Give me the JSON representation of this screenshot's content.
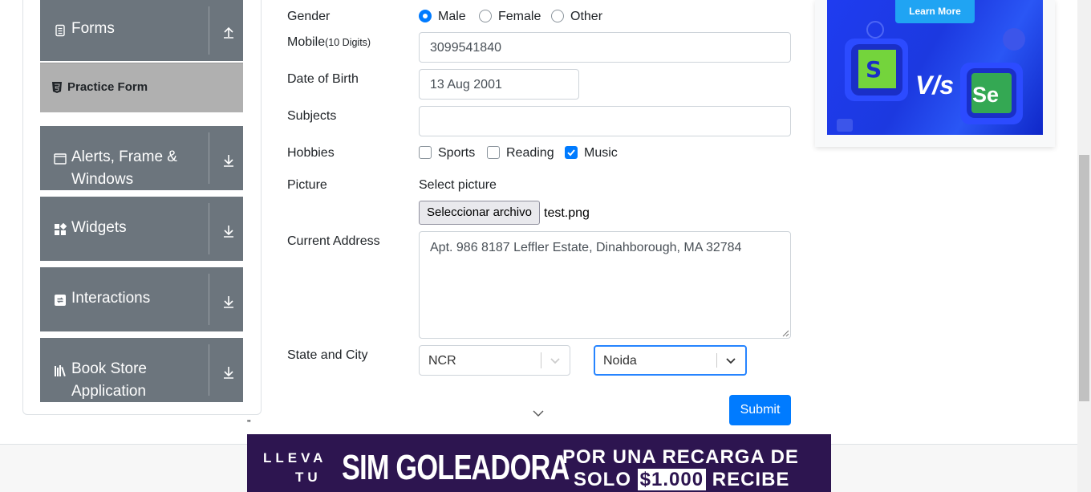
{
  "sidebar": {
    "groups": {
      "forms": "Forms",
      "alerts": "Alerts, Frame & Windows",
      "widgets": "Widgets",
      "interactions": "Interactions",
      "bookstore": "Book Store Application"
    },
    "active_item": "Practice Form"
  },
  "form": {
    "gender": {
      "label": "Gender",
      "options": [
        "Male",
        "Female",
        "Other"
      ],
      "selected": "Male"
    },
    "mobile": {
      "label": "Mobile",
      "note": "(10 Digits)",
      "value": "3099541840"
    },
    "dob": {
      "label": "Date of Birth",
      "value": "13 Aug 2001"
    },
    "subjects": {
      "label": "Subjects",
      "value": ""
    },
    "hobbies": {
      "label": "Hobbies",
      "options": [
        "Sports",
        "Reading",
        "Music"
      ],
      "checked": [
        "Music"
      ]
    },
    "picture": {
      "label": "Picture",
      "select_text": "Select picture",
      "button_label": "Seleccionar archivo",
      "file_name": "test.png"
    },
    "address": {
      "label": "Current Address",
      "value": "Apt. 986 8187 Leffler Estate, Dinahborough, MA 32784"
    },
    "state_city": {
      "label": "State and City",
      "state": "NCR",
      "city": "Noida"
    },
    "submit_label": "Submit"
  },
  "ads": {
    "top_right": {
      "button_label": "Learn More",
      "vs_text": "V/s",
      "left_logo": "S",
      "right_logo": "Se"
    },
    "bottom": {
      "line1": "LLEVA",
      "line2": "TU",
      "big_text": "SIM GOLEADORA",
      "right1": "POR UNA RECARGA DE",
      "right2_pre": "SOLO ",
      "right2_price": "$1.000",
      "right2_post": " RECIBE"
    }
  },
  "misc": {
    "stray_quote": "\""
  },
  "colors": {
    "primary": "#007bff",
    "sidebar_header": "#6c757d",
    "active_item": "#b0b0b0",
    "ad_blue": "#1f3cf0",
    "banner_purple": "#2d1550"
  },
  "icons": [
    "form-icon",
    "chevron-up-icon",
    "html5-icon",
    "window-icon",
    "chevron-down-icon",
    "widgets-icon",
    "interactions-icon",
    "books-icon",
    "dropdown-chevron-icon",
    "scroll-down-icon"
  ]
}
